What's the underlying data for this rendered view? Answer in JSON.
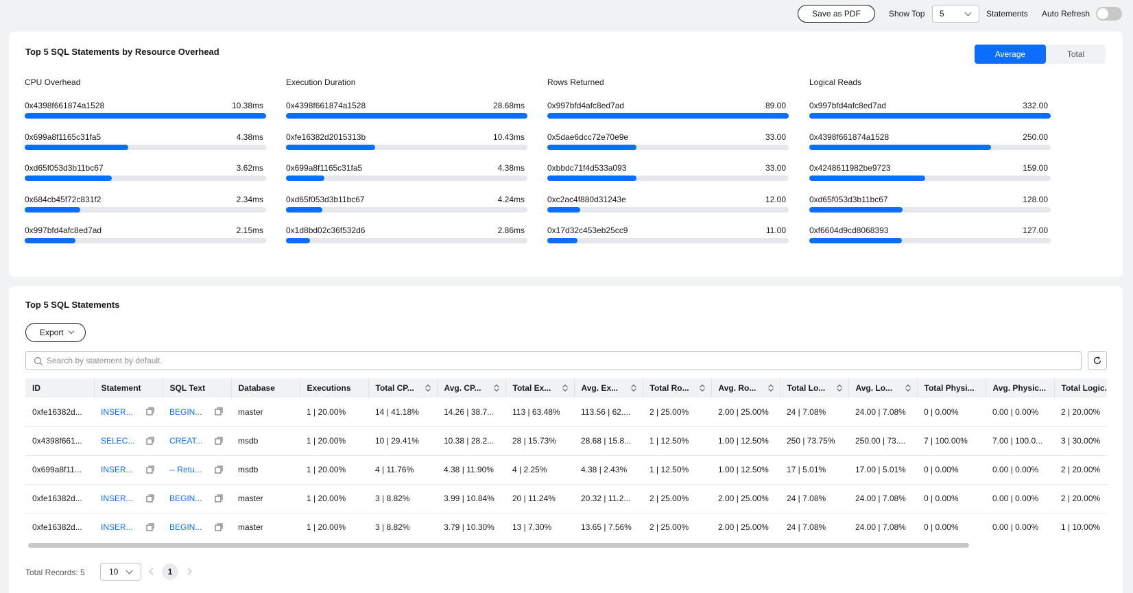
{
  "toolbar": {
    "save_pdf": "Save as PDF",
    "show_top": "Show Top",
    "show_top_value": "5",
    "statements": "Statements",
    "auto_refresh": "Auto Refresh"
  },
  "overhead": {
    "title": "Top 5 SQL Statements by Resource Overhead",
    "seg_average": "Average",
    "seg_total": "Total",
    "metrics": [
      {
        "title": "CPU Overhead",
        "items": [
          {
            "id": "0x4398f661874a1528",
            "value": "10.38ms",
            "ratio": 1.0
          },
          {
            "id": "0x699a8f1165c31fa5",
            "value": "4.38ms",
            "ratio": 0.43
          },
          {
            "id": "0xd65f053d3b11bc67",
            "value": "3.62ms",
            "ratio": 0.36
          },
          {
            "id": "0x684cb45f72c831f2",
            "value": "2.34ms",
            "ratio": 0.23
          },
          {
            "id": "0x997bfd4afc8ed7ad",
            "value": "2.15ms",
            "ratio": 0.21
          }
        ]
      },
      {
        "title": "Execution Duration",
        "items": [
          {
            "id": "0x4398f661874a1528",
            "value": "28.68ms",
            "ratio": 1.0
          },
          {
            "id": "0xfe16382d2015313b",
            "value": "10.43ms",
            "ratio": 0.37
          },
          {
            "id": "0x699a8f1165c31fa5",
            "value": "4.38ms",
            "ratio": 0.16
          },
          {
            "id": "0xd65f053d3b11bc67",
            "value": "4.24ms",
            "ratio": 0.15
          },
          {
            "id": "0x1d8bd02c36f532d6",
            "value": "2.86ms",
            "ratio": 0.1
          }
        ]
      },
      {
        "title": "Rows Returned",
        "items": [
          {
            "id": "0x997bfd4afc8ed7ad",
            "value": "89.00",
            "ratio": 1.0
          },
          {
            "id": "0x5dae6dcc72e70e9e",
            "value": "33.00",
            "ratio": 0.37
          },
          {
            "id": "0xbbdc71f4d533a093",
            "value": "33.00",
            "ratio": 0.37
          },
          {
            "id": "0xc2ac4f880d31243e",
            "value": "12.00",
            "ratio": 0.135
          },
          {
            "id": "0x17d32c453eb25cc9",
            "value": "11.00",
            "ratio": 0.124
          }
        ]
      },
      {
        "title": "Logical Reads",
        "items": [
          {
            "id": "0x997bfd4afc8ed7ad",
            "value": "332.00",
            "ratio": 1.0
          },
          {
            "id": "0x4398f661874a1528",
            "value": "250.00",
            "ratio": 0.753
          },
          {
            "id": "0x4248611982be9723",
            "value": "159.00",
            "ratio": 0.479
          },
          {
            "id": "0xd65f053d3b11bc67",
            "value": "128.00",
            "ratio": 0.386
          },
          {
            "id": "0xf6604d9cd8068393",
            "value": "127.00",
            "ratio": 0.383
          }
        ]
      }
    ]
  },
  "statements": {
    "title": "Top 5 SQL Statements",
    "export": "Export",
    "search_placeholder": "Search by statement by default.",
    "columns": [
      "ID",
      "Statement",
      "SQL Text",
      "Database",
      "Executions",
      "Total CP...",
      "Avg. CP...",
      "Total Ex...",
      "Avg. Ex...",
      "Total Ro...",
      "Avg. Ro...",
      "Total Lo...",
      "Avg. Lo...",
      "Total Physi...",
      "Avg. Physic...",
      "Total Logic..."
    ],
    "rows": [
      [
        "0xfe16382d...",
        "INSER...",
        "BEGIN...",
        "master",
        "1 | 20.00%",
        "14 | 41.18%",
        "14.26 | 38.7...",
        "113 | 63.48%",
        "113.56 | 62....",
        "2 | 25.00%",
        "2.00 | 25.00%",
        "24 | 7.08%",
        "24.00 | 7.08%",
        "0 | 0.00%",
        "0.00 | 0.00%",
        "2 | 20.00%"
      ],
      [
        "0x4398f661...",
        "SELEC...",
        "CREAT...",
        "msdb",
        "1 | 20.00%",
        "10 | 29.41%",
        "10.38 | 28.2...",
        "28 | 15.73%",
        "28.68 | 15.8...",
        "1 | 12.50%",
        "1.00 | 12.50%",
        "250 | 73.75%",
        "250.00 | 73....",
        "7 | 100.00%",
        "7.00 | 100.0...",
        "3 | 30.00%"
      ],
      [
        "0x699a8f11...",
        "INSER...",
        "-- Retu...",
        "msdb",
        "1 | 20.00%",
        "4 | 11.76%",
        "4.38 | 11.90%",
        "4 | 2.25%",
        "4.38 | 2.43%",
        "1 | 12.50%",
        "1.00 | 12.50%",
        "17 | 5.01%",
        "17.00 | 5.01%",
        "0 | 0.00%",
        "0.00 | 0.00%",
        "2 | 20.00%"
      ],
      [
        "0xfe16382d...",
        "INSER...",
        "BEGIN...",
        "master",
        "1 | 20.00%",
        "3 | 8.82%",
        "3.99 | 10.84%",
        "20 | 11.24%",
        "20.32 | 11.2...",
        "2 | 25.00%",
        "2.00 | 25.00%",
        "24 | 7.08%",
        "24.00 | 7.08%",
        "0 | 0.00%",
        "0.00 | 0.00%",
        "2 | 20.00%"
      ],
      [
        "0xfe16382d...",
        "INSER...",
        "BEGIN...",
        "master",
        "1 | 20.00%",
        "3 | 8.82%",
        "3.79 | 10.30%",
        "13 | 7.30%",
        "13.65 | 7.56%",
        "2 | 25.00%",
        "2.00 | 25.00%",
        "24 | 7.08%",
        "24.00 | 7.08%",
        "0 | 0.00%",
        "0.00 | 0.00%",
        "1 | 10.00%"
      ]
    ],
    "total_records": "Total Records: 5",
    "page_size": "10",
    "current_page": "1"
  }
}
